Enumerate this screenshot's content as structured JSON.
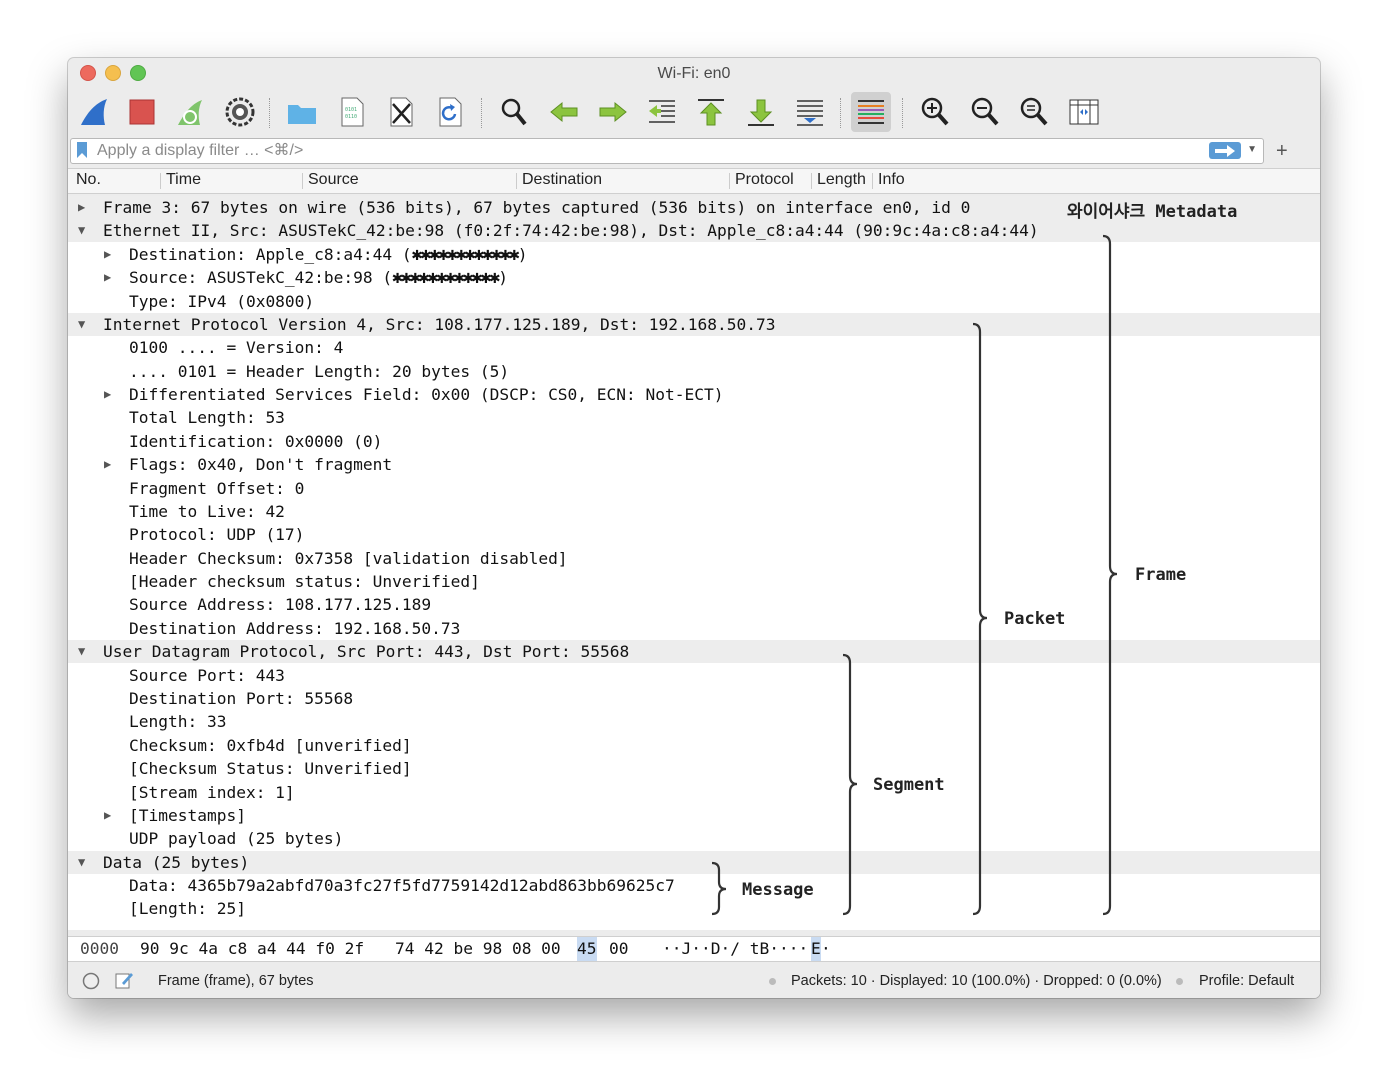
{
  "window": {
    "title": "Wi-Fi: en0"
  },
  "toolbar": {
    "buttons": [
      {
        "name": "start-capture",
        "icon": "shark-fin-icon"
      },
      {
        "name": "stop-capture",
        "icon": "stop-square-icon"
      },
      {
        "name": "restart-capture",
        "icon": "restart-fin-icon"
      },
      {
        "name": "capture-options",
        "icon": "gear-icon"
      },
      {
        "name": "open-file",
        "icon": "folder-icon"
      },
      {
        "name": "save-file",
        "icon": "document-icon"
      },
      {
        "name": "close-file",
        "icon": "close-document-icon"
      },
      {
        "name": "reload-file",
        "icon": "reload-icon"
      },
      {
        "name": "find-packet",
        "icon": "magnifier-icon"
      },
      {
        "name": "go-back",
        "icon": "arrow-left-icon"
      },
      {
        "name": "go-forward",
        "icon": "arrow-right-icon"
      },
      {
        "name": "go-to-packet",
        "icon": "goto-packet-icon"
      },
      {
        "name": "go-first",
        "icon": "arrow-up-icon"
      },
      {
        "name": "go-last",
        "icon": "arrow-down-icon"
      },
      {
        "name": "auto-scroll",
        "icon": "autoscroll-icon"
      },
      {
        "name": "colorize",
        "icon": "colorize-lines-icon"
      },
      {
        "name": "zoom-in",
        "icon": "zoom-in-icon"
      },
      {
        "name": "zoom-out",
        "icon": "zoom-out-icon"
      },
      {
        "name": "zoom-normal",
        "icon": "zoom-normal-icon"
      },
      {
        "name": "resize-columns",
        "icon": "resize-columns-icon"
      }
    ]
  },
  "filter": {
    "placeholder": "Apply a display filter … <⌘/>",
    "value": "",
    "plus": "+"
  },
  "columns": [
    "No.",
    "Time",
    "Source",
    "Destination",
    "Protocol",
    "Length",
    "Info"
  ],
  "tree": [
    {
      "indent": 0,
      "arrow": "▶",
      "text": "Frame 3: 67 bytes on wire (536 bits), 67 bytes captured (536 bits) on interface en0, id 0",
      "hl": true
    },
    {
      "indent": 0,
      "arrow": "▼",
      "text": "Ethernet II, Src: ASUSTekC_42:be:98 (f0:2f:74:42:be:98), Dst: Apple_c8:a4:44 (90:9c:4a:c8:a4:44)",
      "hl": true
    },
    {
      "indent": 1,
      "arrow": "▶",
      "text": "Destination: Apple_c8:a4:44 (",
      "censor": "✱✱✱✱✱✱✱✱✱✱✱✱",
      "after": ")"
    },
    {
      "indent": 1,
      "arrow": "▶",
      "text": "Source: ASUSTekC_42:be:98 (",
      "censor": "✱✱✱✱✱✱✱✱✱✱✱✱",
      "after": ")"
    },
    {
      "indent": 1,
      "arrow": "",
      "text": "Type: IPv4 (0x0800)"
    },
    {
      "indent": 0,
      "arrow": "▼",
      "text": "Internet Protocol Version 4, Src: 108.177.125.189, Dst: 192.168.50.73",
      "hl": true
    },
    {
      "indent": 1,
      "arrow": "",
      "text": "0100 .... = Version: 4"
    },
    {
      "indent": 1,
      "arrow": "",
      "text": ".... 0101 = Header Length: 20 bytes (5)"
    },
    {
      "indent": 1,
      "arrow": "▶",
      "text": "Differentiated Services Field: 0x00 (DSCP: CS0, ECN: Not-ECT)"
    },
    {
      "indent": 1,
      "arrow": "",
      "text": "Total Length: 53"
    },
    {
      "indent": 1,
      "arrow": "",
      "text": "Identification: 0x0000 (0)"
    },
    {
      "indent": 1,
      "arrow": "▶",
      "text": "Flags: 0x40, Don't fragment"
    },
    {
      "indent": 1,
      "arrow": "",
      "text": "Fragment Offset: 0"
    },
    {
      "indent": 1,
      "arrow": "",
      "text": "Time to Live: 42"
    },
    {
      "indent": 1,
      "arrow": "",
      "text": "Protocol: UDP (17)"
    },
    {
      "indent": 1,
      "arrow": "",
      "text": "Header Checksum: 0x7358 [validation disabled]"
    },
    {
      "indent": 1,
      "arrow": "",
      "text": "[Header checksum status: Unverified]"
    },
    {
      "indent": 1,
      "arrow": "",
      "text": "Source Address: 108.177.125.189"
    },
    {
      "indent": 1,
      "arrow": "",
      "text": "Destination Address: 192.168.50.73"
    },
    {
      "indent": 0,
      "arrow": "▼",
      "text": "User Datagram Protocol, Src Port: 443, Dst Port: 55568",
      "hl": true
    },
    {
      "indent": 1,
      "arrow": "",
      "text": "Source Port: 443"
    },
    {
      "indent": 1,
      "arrow": "",
      "text": "Destination Port: 55568"
    },
    {
      "indent": 1,
      "arrow": "",
      "text": "Length: 33"
    },
    {
      "indent": 1,
      "arrow": "",
      "text": "Checksum: 0xfb4d [unverified]"
    },
    {
      "indent": 1,
      "arrow": "",
      "text": "[Checksum Status: Unverified]"
    },
    {
      "indent": 1,
      "arrow": "",
      "text": "[Stream index: 1]"
    },
    {
      "indent": 1,
      "arrow": "▶",
      "text": "[Timestamps]"
    },
    {
      "indent": 1,
      "arrow": "",
      "text": "UDP payload (25 bytes)"
    },
    {
      "indent": 0,
      "arrow": "▼",
      "text": "Data (25 bytes)",
      "hl": true
    },
    {
      "indent": 1,
      "arrow": "",
      "text": "Data: 4365b79a2abfd70a3fc27f5fd7759142d12abd863bb69625c7"
    },
    {
      "indent": 1,
      "arrow": "",
      "text": "[Length: 25]"
    }
  ],
  "annotations": {
    "metadata": "와이어샤크 Metadata",
    "frame": "Frame",
    "packet": "Packet",
    "segment": "Segment",
    "message": "Message"
  },
  "hex": {
    "offset": "0000",
    "bytes_a": "90 9c 4a c8 a4 44 f0 2f",
    "bytes_b": "74 42 be 98 08 00",
    "byte_hl": "45",
    "byte_c": "00",
    "ascii_a": "··J··D·/ tB····",
    "ascii_hl": "E",
    "ascii_b": "·"
  },
  "status": {
    "frame": "Frame (frame), 67 bytes",
    "packets": "Packets: 10 · Displayed: 10 (100.0%) · Dropped: 0 (0.0%)",
    "profile": "Profile: Default"
  },
  "colors": {
    "accent": "#5b9bd5",
    "highlight_row": "#ededed",
    "byte_highlight": "#c9dbf2"
  }
}
